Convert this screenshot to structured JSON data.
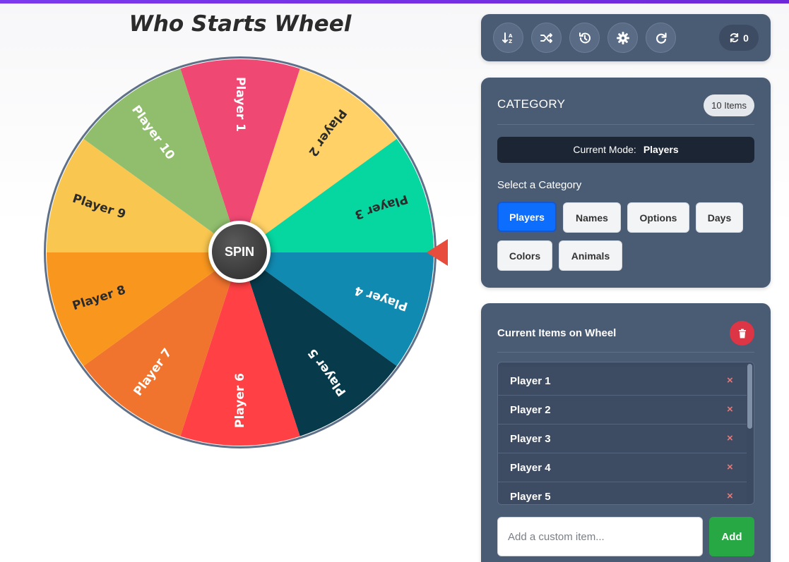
{
  "page": {
    "title": "Who Starts Wheel"
  },
  "wheel": {
    "spin_label": "SPIN",
    "segments": [
      {
        "label": "Player 1",
        "color": "#ef4872",
        "text_color": "#ffffff"
      },
      {
        "label": "Player 2",
        "color": "#ffd166",
        "text_color": "#2b2b2b"
      },
      {
        "label": "Player 3",
        "color": "#06d6a0",
        "text_color": "#2b2b2b"
      },
      {
        "label": "Player 4",
        "color": "#118ab2",
        "text_color": "#ffffff"
      },
      {
        "label": "Player 5",
        "color": "#073b4c",
        "text_color": "#ffffff"
      },
      {
        "label": "Player 6",
        "color": "#ff4044",
        "text_color": "#ffffff"
      },
      {
        "label": "Player 7",
        "color": "#f0732e",
        "text_color": "#ffffff"
      },
      {
        "label": "Player 8",
        "color": "#f8961e",
        "text_color": "#2b2b2b"
      },
      {
        "label": "Player 9",
        "color": "#f9c74f",
        "text_color": "#2b2b2b"
      },
      {
        "label": "Player 10",
        "color": "#90be6d",
        "text_color": "#ffffff"
      }
    ],
    "pointer_color": "#e74c3c"
  },
  "toolbar": {
    "buttons": [
      {
        "name": "sort-button",
        "icon": "sort-icon"
      },
      {
        "name": "shuffle-button",
        "icon": "shuffle-icon"
      },
      {
        "name": "history-button",
        "icon": "history-icon"
      },
      {
        "name": "settings-button",
        "icon": "gear-icon"
      },
      {
        "name": "reset-button",
        "icon": "redo-icon"
      }
    ],
    "spin_count": "0"
  },
  "category": {
    "title": "CATEGORY",
    "count_badge": "10 Items",
    "mode_label": "Current Mode:",
    "mode_value": "Players",
    "select_label": "Select a Category",
    "options": [
      "Players",
      "Names",
      "Options",
      "Days",
      "Colors",
      "Animals"
    ],
    "active": "Players"
  },
  "items": {
    "title": "Current Items on Wheel",
    "list": [
      "Player 1",
      "Player 2",
      "Player 3",
      "Player 4",
      "Player 5"
    ],
    "remove_symbol": "×",
    "input_placeholder": "Add a custom item...",
    "add_label": "Add"
  },
  "colors": {
    "panel": "#4a5b74",
    "accent_blue": "#0d6efd",
    "add_green": "#28a745",
    "danger_red": "#dc3545"
  }
}
